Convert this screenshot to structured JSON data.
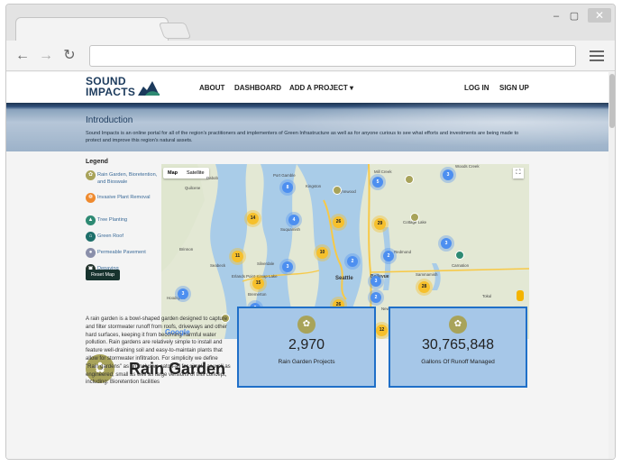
{
  "browser": {
    "controls": {
      "minimize": "–",
      "maximize": "▢",
      "close": "✕"
    },
    "nav": {
      "back": "←",
      "forward": "→",
      "reload": "↻"
    },
    "address_value": ""
  },
  "site": {
    "logo": {
      "line1": "SOUND",
      "line2": "IMPACTS"
    },
    "nav": {
      "about": "ABOUT",
      "dashboard": "DASHBOARD",
      "add_project": "ADD A PROJECT ▾",
      "login": "LOG IN",
      "signup": "SIGN UP"
    }
  },
  "intro": {
    "title": "Introduction",
    "text": "Sound Impacts is an online portal for all of the region's practitioners and implementers of Green Infrastructure as well as for anyone curious to see what efforts and investments are being made to protect and improve this region's natural assets."
  },
  "legend": {
    "title": "Legend",
    "items": [
      {
        "label": "Rain Garden, Bioretention, and Bioswale",
        "icon": "leaf-icon",
        "color": "#a8a35a"
      },
      {
        "label": "Invasive Plant Removal",
        "icon": "plant-removal-icon",
        "color": "#ef8a2e"
      },
      {
        "label": "Tree Planting",
        "icon": "tree-icon",
        "color": "#2e8a73"
      },
      {
        "label": "Green Roof",
        "icon": "house-icon",
        "color": "#1e6f6a"
      },
      {
        "label": "Permeable Pavement",
        "icon": "drop-icon",
        "color": "#8a8faa"
      },
      {
        "label": "Depaving",
        "icon": "depave-icon",
        "color": "#23332c"
      }
    ],
    "reset_label": "Reset Map"
  },
  "map": {
    "type_map": "Map",
    "type_satellite": "Satellite",
    "google": "Google",
    "footer": "Map data ©2017 Google   Terms of Use   Report a map error",
    "places": [
      "Dabob",
      "Port Gamble",
      "Mill Creek",
      "Woods Creek",
      "Quilcene",
      "Kingston",
      "Lynnwood",
      "Suquamish",
      "Cottage Lake",
      "Brinnon",
      "Redmond",
      "Seabeck",
      "Silverdale",
      "Seattle",
      "Bellevue",
      "Sammamish",
      "Carnation",
      "Erlands Point-Kitsap Lake",
      "Bremerton",
      "Hoodsport",
      "Newcastle",
      "Issaquah",
      "Lake Morton-Berrydale",
      "Tokul",
      "Renton",
      "Port Orchard"
    ],
    "clusters": [
      "8",
      "4",
      "14",
      "26",
      "29",
      "10",
      "11",
      "2",
      "2",
      "3",
      "26",
      "15",
      "3",
      "2",
      "28",
      "2",
      "18",
      "12",
      "34",
      "3",
      "5",
      "3",
      "2",
      "3"
    ]
  },
  "rain_garden": {
    "title": "Rain Garden",
    "text": "A rain garden is a bowl-shaped garden designed to capture and filter stormwater runoff from roofs, driveways and other hard surfaces, keeping it from becoming harmful water pollution. Rain gardens are relatively simple to install and feature well-draining soil and easy-to-maintain plants that allow for stormwater infiltration. For simplicity we define \"Rain gardens\" as an inclusive catch-all for simple as well as engineered, small as well as large versions of this concept, including: Bioretention facilities",
    "stats": [
      {
        "value": "2,970",
        "label": "Rain Garden Projects"
      },
      {
        "value": "30,765,848",
        "label": "Gallons Of Runoff Managed"
      }
    ]
  }
}
